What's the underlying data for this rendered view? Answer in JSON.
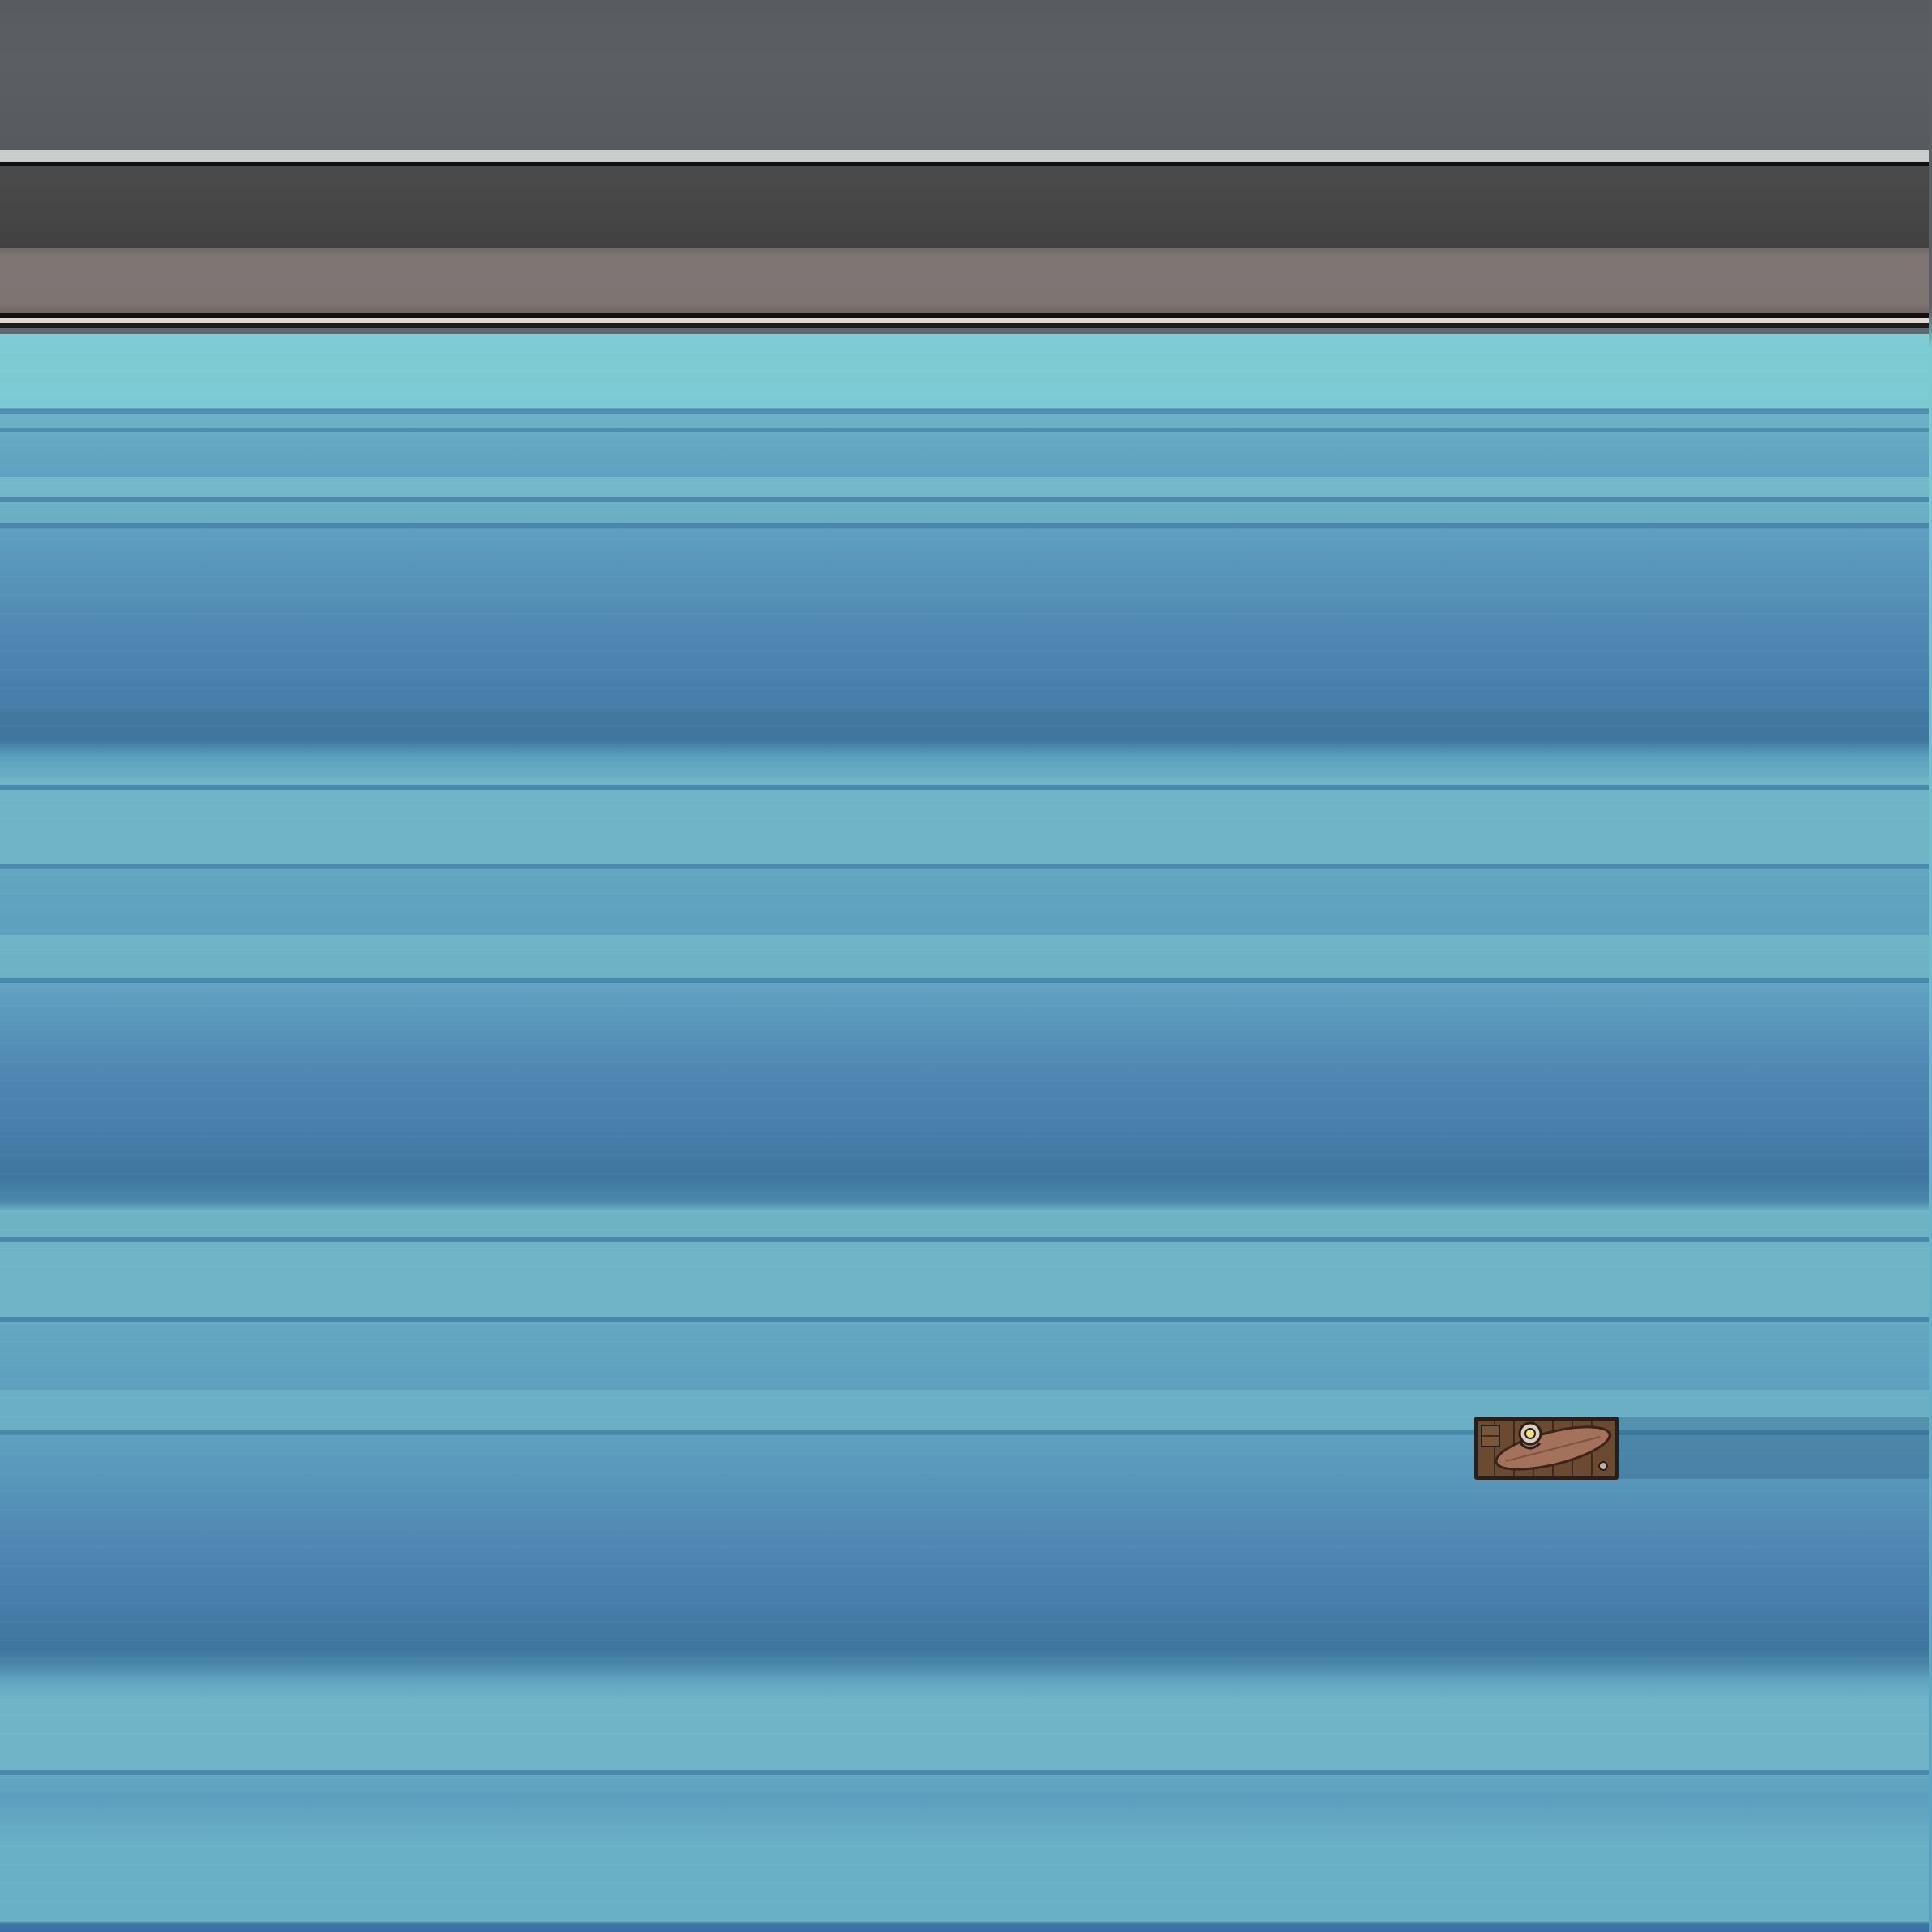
{
  "scene": {
    "type": "top-down game view",
    "environment": "dock and water",
    "colors": {
      "dock": "#595d61",
      "dock_plank": "#7e7573",
      "water_light": "#7fcdd3",
      "water_mid": "#6eb2c6",
      "water_deep": "#477eac",
      "boat_wood": "#8a5a3a",
      "boat_frame": "#2a1f18"
    }
  },
  "player": {
    "vehicle": "wooden-raft-icon",
    "character": "character-icon",
    "item": "surfboard-icon"
  }
}
